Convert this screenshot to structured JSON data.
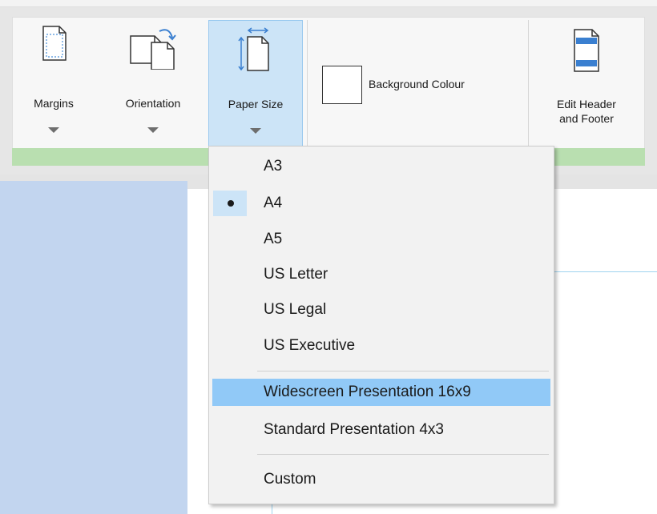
{
  "ribbon": {
    "margins_label": "Margins",
    "orientation_label": "Orientation",
    "paper_size_label": "Paper Size",
    "background_colour_label": "Background Colour",
    "edit_header_footer_line1": "Edit Header",
    "edit_header_footer_line2": "and Footer",
    "active_button": "Paper Size",
    "background_colour_value": "#ffffff"
  },
  "paper_size_menu": {
    "items": [
      {
        "label": "A3",
        "checked": false,
        "highlighted": false
      },
      {
        "label": "A4",
        "checked": true,
        "highlighted": false
      },
      {
        "label": "A5",
        "checked": false,
        "highlighted": false
      },
      {
        "label": "US Letter",
        "checked": false,
        "highlighted": false
      },
      {
        "label": "US Legal",
        "checked": false,
        "highlighted": false
      },
      {
        "label": "US Executive",
        "checked": false,
        "highlighted": false
      },
      {
        "label": "Widescreen Presentation 16x9",
        "checked": false,
        "highlighted": true
      },
      {
        "label": "Standard Presentation 4x3",
        "checked": false,
        "highlighted": false
      },
      {
        "label": "Custom",
        "checked": false,
        "highlighted": false
      }
    ]
  },
  "colors": {
    "ribbon_group_bar": "#b9dfb0",
    "active_button_bg": "#cce4f7",
    "menu_highlight": "#91c9f7",
    "page_margin_area": "#c2d5ef"
  },
  "icons": {
    "margins": "margins-icon",
    "orientation": "orientation-icon",
    "paper_size": "paper-size-icon",
    "edit_header_footer": "header-footer-icon"
  }
}
